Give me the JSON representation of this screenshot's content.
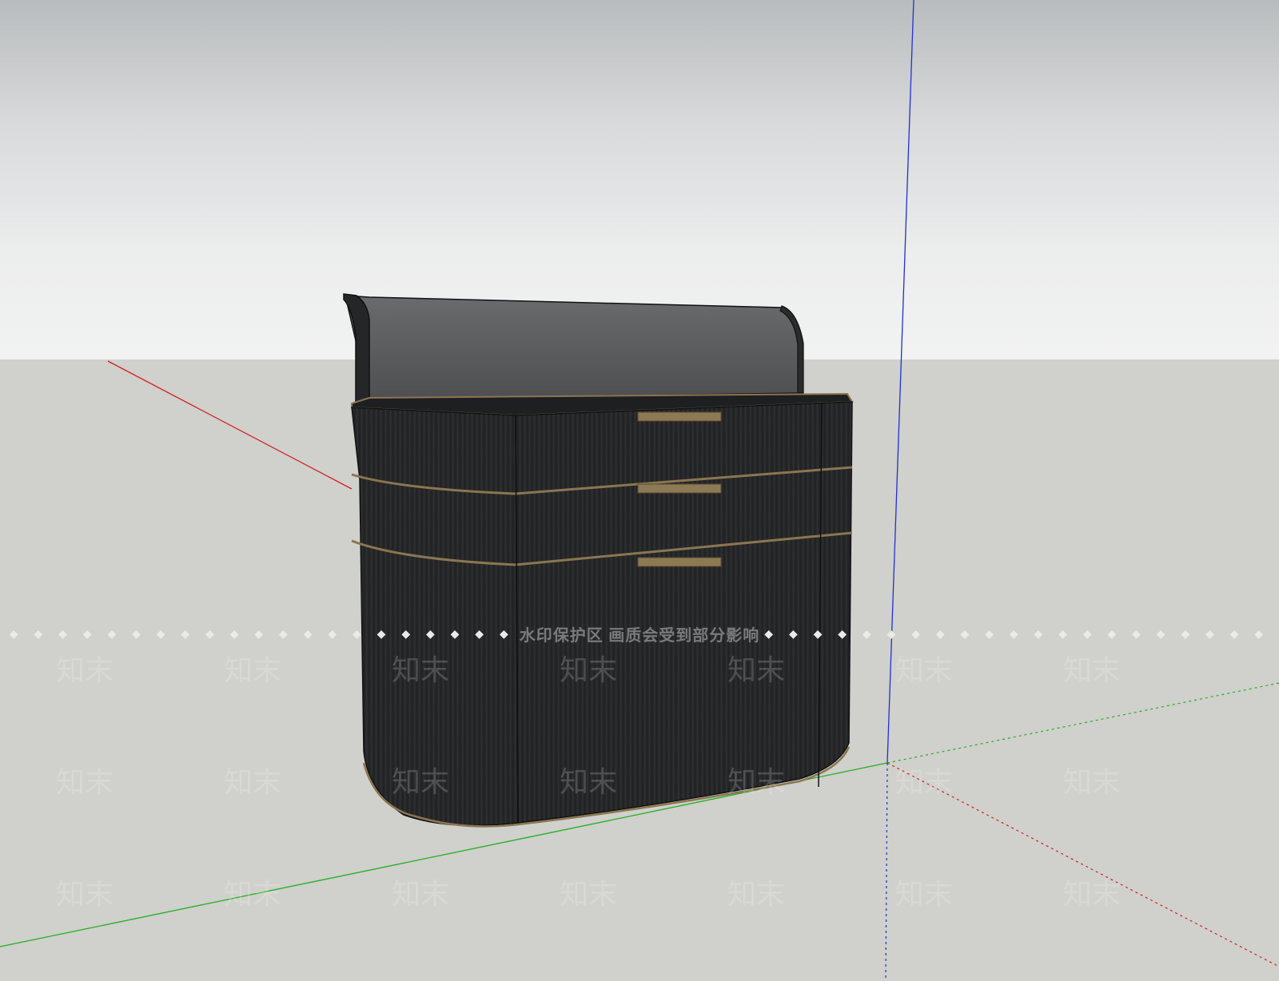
{
  "viewport": {
    "sky_top_color": "#b9bcbe",
    "sky_bottom_color": "#f2f2f2",
    "ground_color": "#d0d0cc"
  },
  "axes": {
    "red_axis_color": "#d02020",
    "green_axis_color": "#20b020",
    "blue_axis_color": "#2030d0"
  },
  "model": {
    "body_color": "#252628",
    "trim_color": "#8a7650",
    "glass_color": "#5a5b5d",
    "handle_color": "#8c7a55"
  },
  "watermark": {
    "banner_text": "水印保护区  画质会受到部分影响",
    "banner_dots": "◆ ◆ ◆ ◆ ◆ ◆ ◆ ◆ ◆ ◆ ◆ ◆ ◆ ◆ ◆ ◆ ◆ ◆ ◆ ◆ ◆ ◆ ◆ ◆ ◆",
    "tile_text": "知末"
  }
}
